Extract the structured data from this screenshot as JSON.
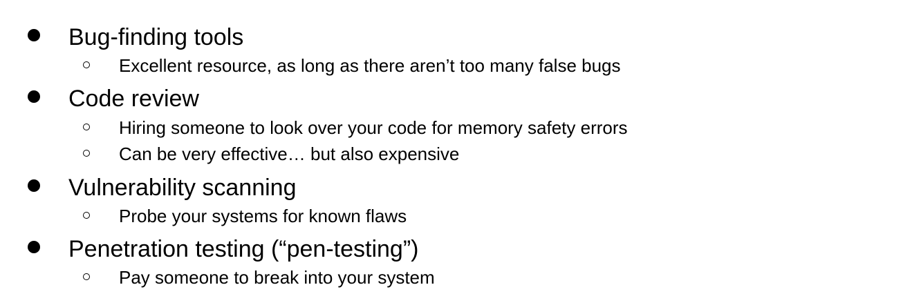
{
  "items": [
    {
      "text": "Bug-finding tools",
      "subitems": [
        "Excellent resource, as long as there aren’t too many false bugs"
      ]
    },
    {
      "text": "Code review",
      "subitems": [
        "Hiring someone to look over your code for memory safety errors",
        "Can be very effective… but also expensive"
      ]
    },
    {
      "text": "Vulnerability scanning",
      "subitems": [
        "Probe your systems for known flaws"
      ]
    },
    {
      "text": "Penetration testing (“pen-testing”)",
      "subitems": [
        "Pay someone to break into your system"
      ]
    }
  ]
}
